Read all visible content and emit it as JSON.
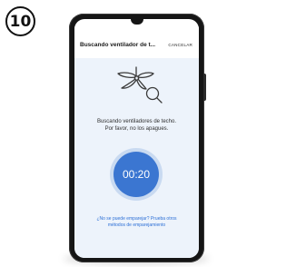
{
  "step": {
    "number": "10"
  },
  "app": {
    "title": "Buscando ventilador de t...",
    "cancel_label": "CANCELAR"
  },
  "status": {
    "line1": "Buscando ventiladores de techo.",
    "line2": "Por favor, no los apagues."
  },
  "timer": {
    "value": "00:20"
  },
  "help": {
    "line1": "¿No se puede emparejar? Prueba otros",
    "line2": "métodos de emparejamiento"
  },
  "colors": {
    "accent": "#3b76d1",
    "link": "#2c6fd6",
    "screen_background": "#edf3fb"
  },
  "icons": [
    "ceiling-fan-search-icon"
  ]
}
